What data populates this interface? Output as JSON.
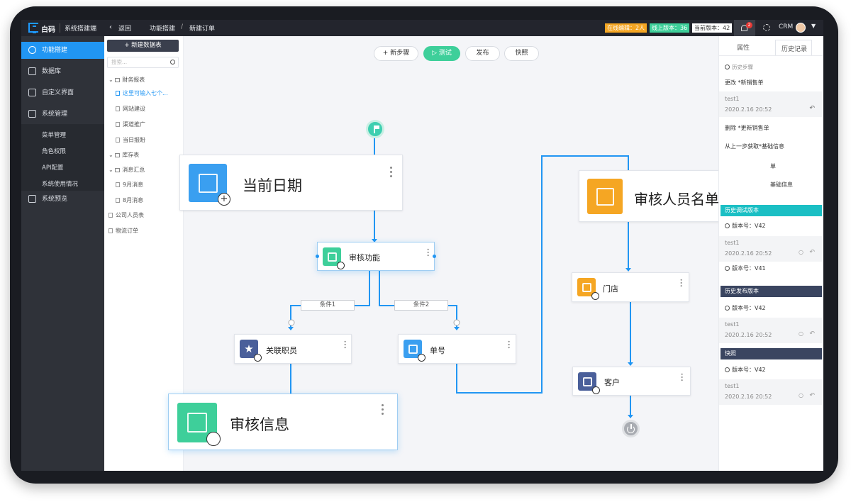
{
  "topbar": {
    "logo": "白码",
    "system_name": "系统搭建端",
    "back": "返回",
    "breadcrumb_parent": "功能搭建",
    "breadcrumb_sep": "/",
    "breadcrumb_current": "新建订单",
    "online_editing": "在线编辑：2人",
    "online_version": "线上版本：36",
    "current_version": "当前版本：42",
    "notification_count": "2",
    "app_name": "CRM",
    "colors": {
      "online_editing": "#f5a623",
      "online_version": "#3ecf9a",
      "current_version": "#ffffff"
    }
  },
  "sidebar": {
    "items": [
      {
        "label": "功能搭建",
        "icon": "cluster-icon",
        "active": true
      },
      {
        "label": "数据库",
        "icon": "database-icon"
      },
      {
        "label": "自定义界面",
        "icon": "custom-ui-icon"
      },
      {
        "label": "系统管理",
        "icon": "monitor-icon"
      }
    ],
    "sub_items": [
      "菜单管理",
      "角色权限",
      "API配置",
      "系统使用情况"
    ],
    "preview": {
      "label": "系统预览",
      "icon": "preview-icon"
    }
  },
  "tree": {
    "new_table": "+ 新建数据表",
    "search_placeholder": "搜索...",
    "nodes": [
      {
        "label": "财务报表",
        "type": "folder"
      },
      {
        "label": "这里可输入七个...",
        "type": "doc",
        "selected": true
      },
      {
        "label": "网站建设",
        "type": "doc"
      },
      {
        "label": "渠道推广",
        "type": "doc"
      },
      {
        "label": "当日报盼",
        "type": "doc"
      },
      {
        "label": "库存表",
        "type": "folder"
      },
      {
        "label": "消息汇总",
        "type": "folder"
      },
      {
        "label": "9月消息",
        "type": "doc"
      },
      {
        "label": "8月消息",
        "type": "doc"
      },
      {
        "label": "公司人员表",
        "type": "doc"
      },
      {
        "label": "物流订单",
        "type": "doc"
      }
    ]
  },
  "toolbar": {
    "new_step": "+ 新步骤",
    "test": "▷ 测试",
    "publish": "发布",
    "snapshot": "快照"
  },
  "flow": {
    "start_icon": "flag-icon",
    "end_icon": "power-icon",
    "nodes": [
      {
        "title": "当前日期",
        "icon": "cube-icon",
        "badge": "plus-icon",
        "color": "#3a9ff0"
      },
      {
        "title": "审核功能",
        "icon": "stack-icon",
        "badge": "search-icon",
        "color": "#3ecf9a"
      },
      {
        "title": "关联职员",
        "icon": "star-icon",
        "badge": "close-icon",
        "color": "#4a5f9a"
      },
      {
        "title": "单号",
        "icon": "cube-icon",
        "badge": "cursor-icon",
        "color": "#3a9ff0"
      },
      {
        "title": "审核信息",
        "icon": "stack-icon",
        "badge": "search-icon",
        "color": "#3ecf9a"
      },
      {
        "title": "审核人员名单",
        "icon": "frame-icon",
        "badge": "",
        "color": "#f5a623"
      },
      {
        "title": "门店",
        "icon": "frame-icon",
        "badge": "fire-icon",
        "color": "#f5a623"
      },
      {
        "title": "客户",
        "icon": "org-chart-icon",
        "badge": "cursor-icon",
        "color": "#4a5f9a"
      }
    ],
    "conditions": [
      "条件1",
      "条件2"
    ]
  },
  "panel": {
    "tab_properties": "属性",
    "tab_history": "历史记录",
    "history_steps": "历史步骤",
    "entries": [
      {
        "text": "更改 *新销售单"
      },
      {
        "user": "test1",
        "time": "2020.2.16  20:52"
      },
      {
        "text": "删除 *更新销售单"
      },
      {
        "text": "从上一步获取*基础信息"
      },
      {
        "text": "单"
      },
      {
        "text": "基础信息"
      }
    ],
    "sections": [
      {
        "title": "历史调试版本",
        "color": "#1bbfc4",
        "versions": [
          {
            "version": "版本号：V42",
            "user": "test1",
            "time": "2020.2.16  20:52"
          },
          {
            "version": "版本号：V41"
          }
        ]
      },
      {
        "title": "历史发布版本",
        "color": "#3a4560",
        "versions": [
          {
            "version": "版本号：V42",
            "user": "test1",
            "time": "2020.2.16  20:52"
          }
        ]
      },
      {
        "title": "快照",
        "color": "#3a4560",
        "versions": [
          {
            "version": "版本号：V42",
            "user": "test1",
            "time": "2020.2.16  20:52"
          }
        ]
      }
    ]
  }
}
